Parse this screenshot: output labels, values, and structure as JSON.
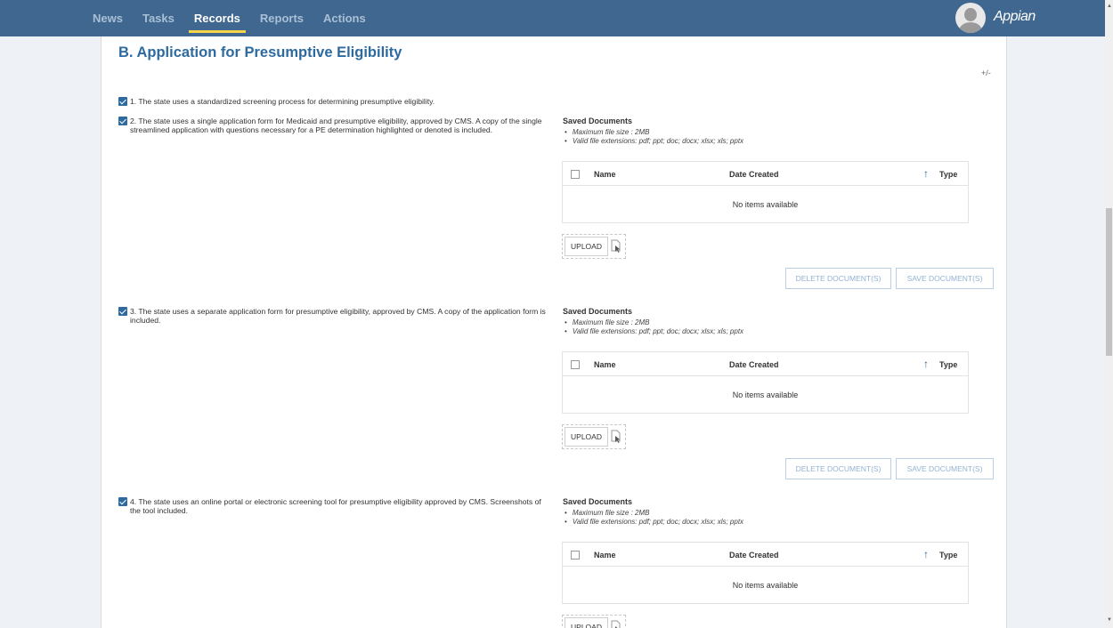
{
  "nav": {
    "items": [
      {
        "label": "News"
      },
      {
        "label": "Tasks"
      },
      {
        "label": "Records"
      },
      {
        "label": "Reports"
      },
      {
        "label": "Actions"
      }
    ],
    "active": "Records",
    "brand": "Appian"
  },
  "section": {
    "title": "B. Application for Presumptive Eligibility",
    "toggle": "+/-"
  },
  "items": [
    {
      "checked": true,
      "text": "1. The state uses a standardized screening process for determining presumptive eligibility."
    },
    {
      "checked": true,
      "text": "2. The state uses a single application form for Medicaid and presumptive eligibility, approved by CMS. A copy of the single streamlined application with questions necessary for a PE determination highlighted or denoted is included."
    },
    {
      "checked": true,
      "text": "3. The state uses a separate application form for presumptive eligibility, approved by CMS. A copy of the application form is included."
    },
    {
      "checked": true,
      "text": "4. The state uses an online portal or electronic screening tool for presumptive eligibility approved by CMS. Screenshots of the tool included."
    }
  ],
  "docs": {
    "title": "Saved Documents",
    "max_size": "Maximum file size : 2MB",
    "extensions": "Valid file extensions: pdf; ppt; doc; docx; xlsx; xls; pptx",
    "columns": {
      "name": "Name",
      "date": "Date Created",
      "type": "Type"
    },
    "empty": "No items available",
    "upload": "UPLOAD",
    "delete": "DELETE DOCUMENT(S)",
    "save": "SAVE DOCUMENT(S)"
  }
}
